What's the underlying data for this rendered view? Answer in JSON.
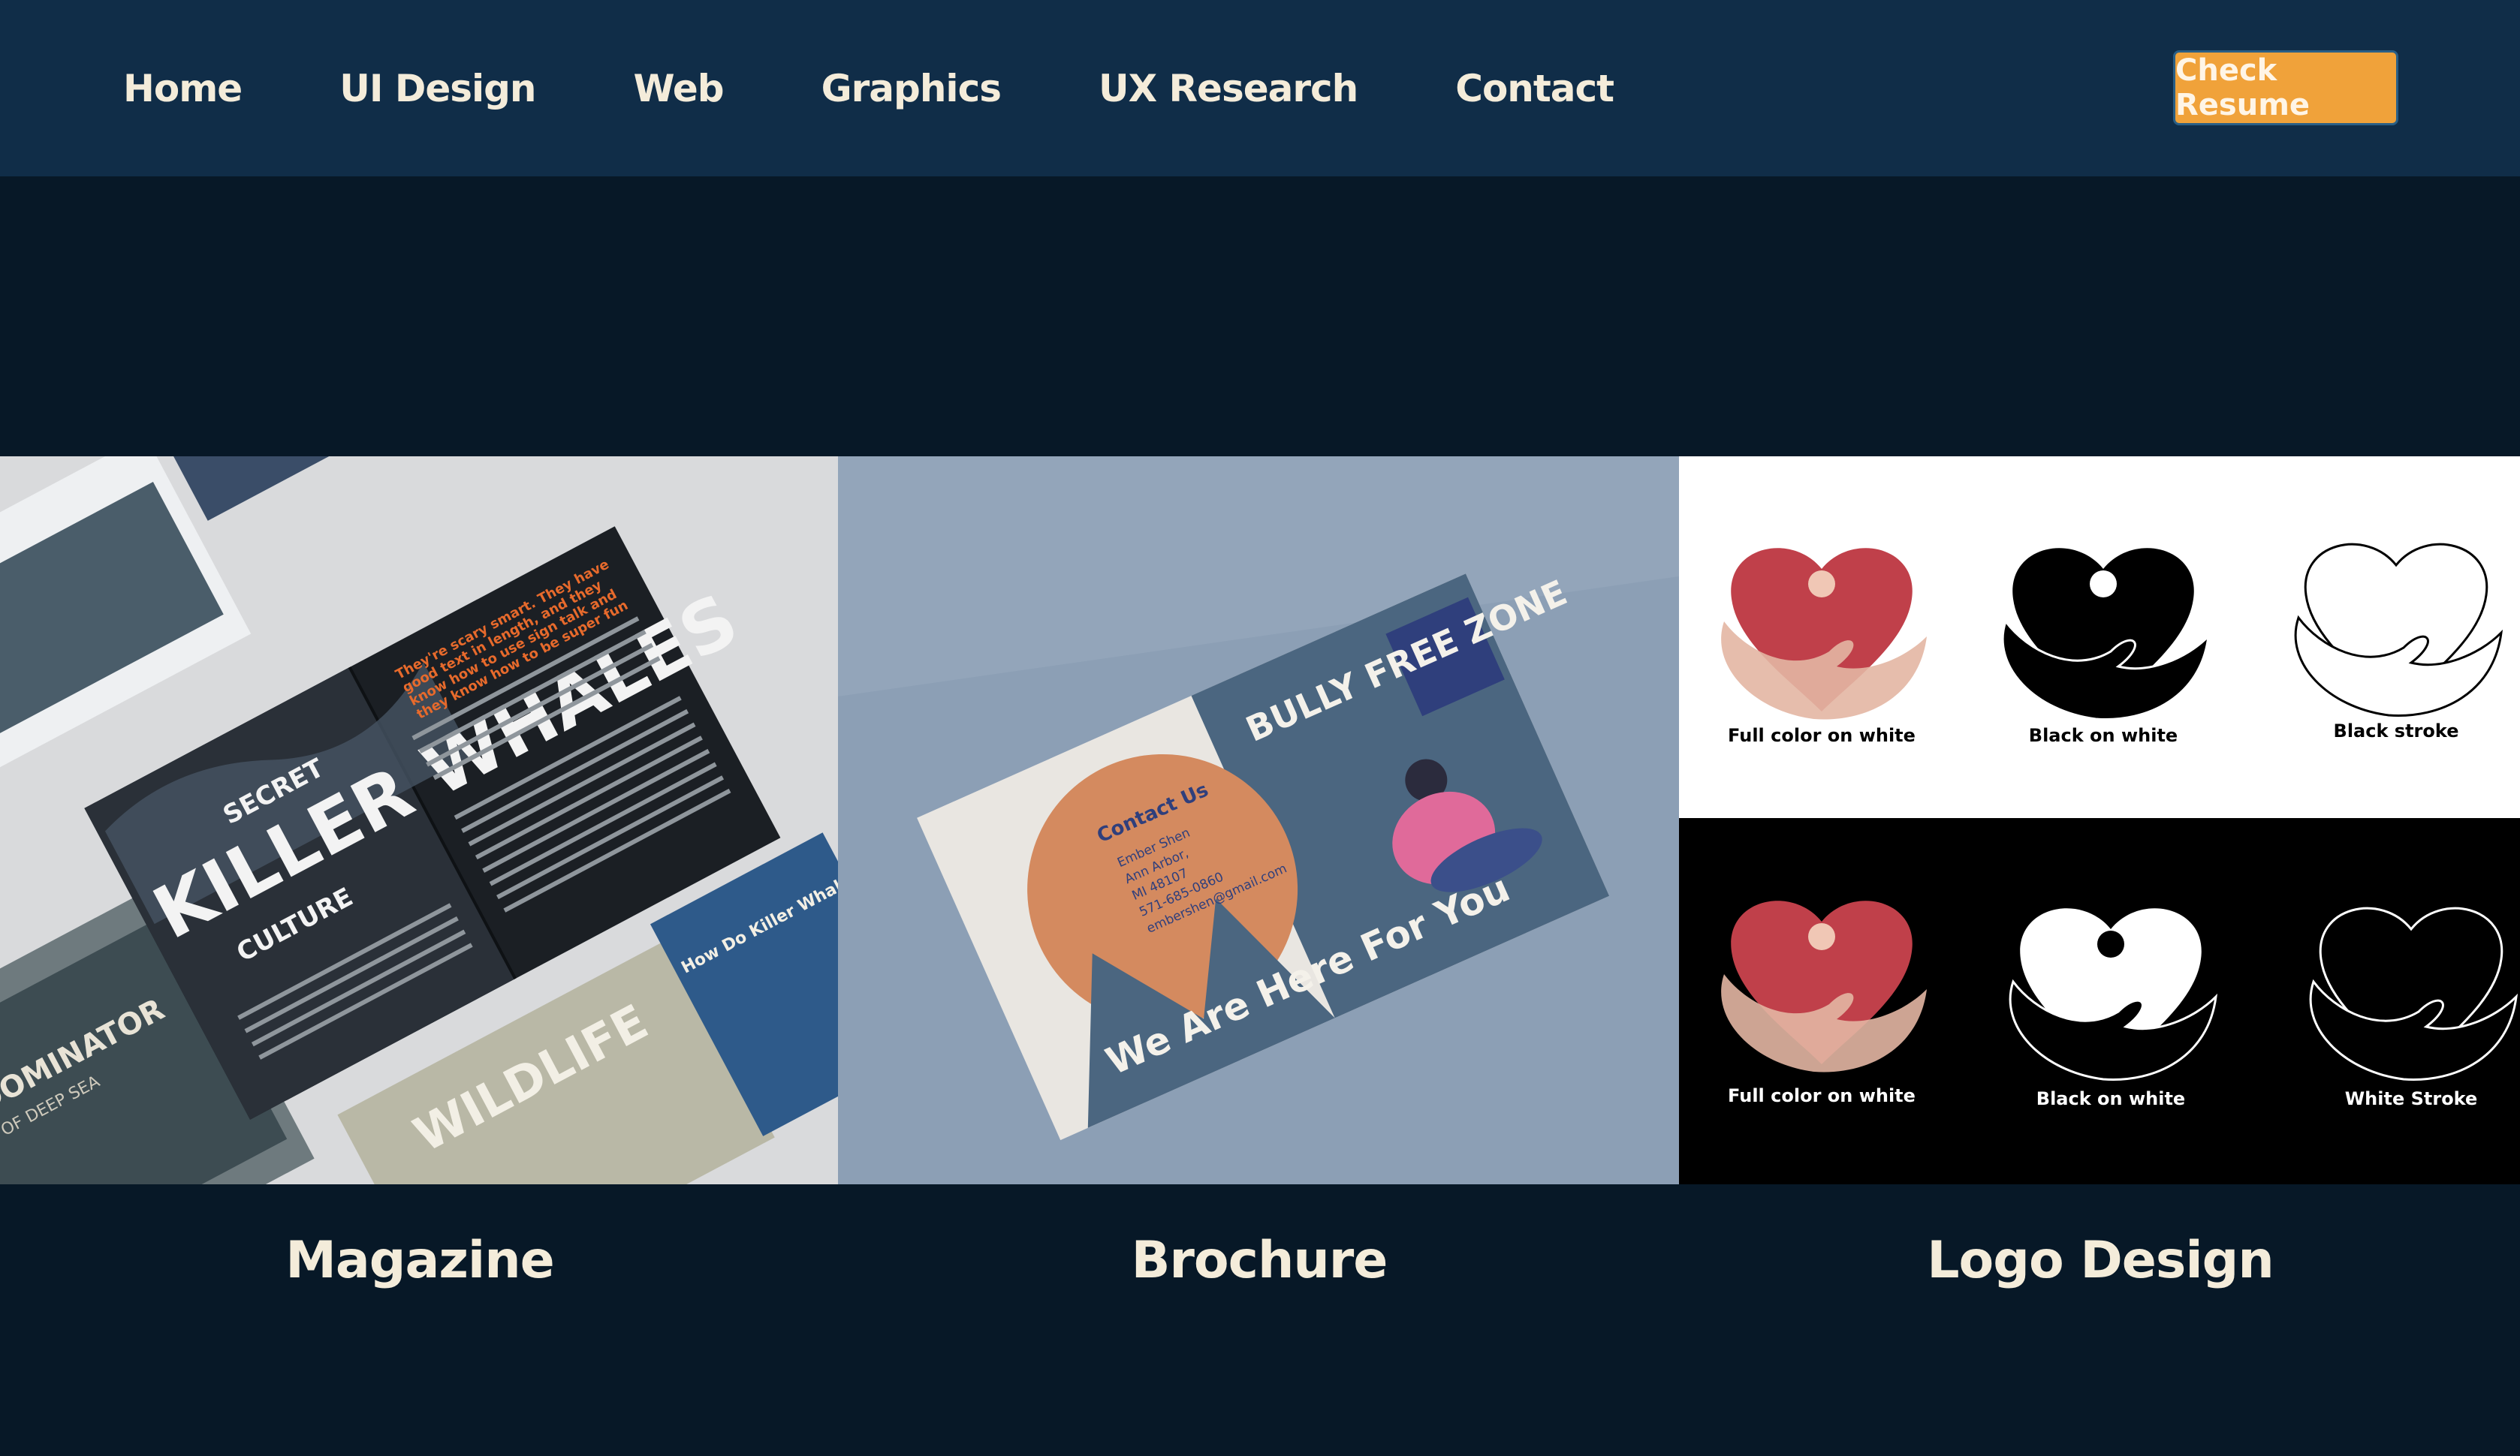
{
  "nav": {
    "items": [
      {
        "label": "Home"
      },
      {
        "label": "UI Design"
      },
      {
        "label": "Web"
      },
      {
        "label": "Graphics"
      },
      {
        "label": "UX Research"
      },
      {
        "label": "Contact"
      }
    ],
    "resume_label": "Check Resume"
  },
  "colors": {
    "nav_bg": "#102d48",
    "page_bg": "#071827",
    "accent": "#f0a23a",
    "text": "#f4ecda",
    "heart_red": "#c0404a"
  },
  "gallery": [
    {
      "caption": "Magazine",
      "image": {
        "headline": "KILLER WHALES",
        "sidewords": [
          "SECRET",
          "CULTURE",
          "SECRET"
        ],
        "quote": "They're scary smart. They have good text in length, and they know how to use sign talk and they know how to be super fun",
        "cover1": "DOMINATOR",
        "cover1_sub": "OF DEEP SEA",
        "cover2": "WILDLIFE",
        "cover3": "How Do Killer Whales"
      }
    },
    {
      "caption": "Brochure",
      "image": {
        "title": "BULLY FREE ZONE",
        "contact_title": "Contact Us",
        "contact_lines": [
          "Ember Shen",
          "Ann Arbor,",
          "MI 48107",
          "571-685-0860",
          "embershen@gmail.com"
        ],
        "slogan": "We Are Here For You"
      }
    },
    {
      "caption": "Logo Design",
      "image": {
        "top_labels": [
          "Full color on white",
          "Black on white",
          "Black stroke"
        ],
        "bottom_labels": [
          "Full color on white",
          "Black on white",
          "White Stroke"
        ]
      }
    }
  ]
}
